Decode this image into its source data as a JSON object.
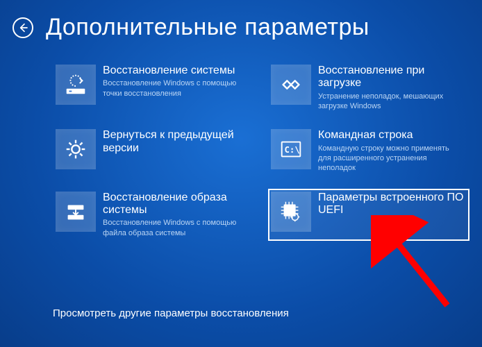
{
  "header": {
    "title": "Дополнительные параметры"
  },
  "tiles": [
    {
      "title": "Восстановление системы",
      "desc": "Восстановление Windows с помощью точки восстановления"
    },
    {
      "title": "Восстановление при загрузке",
      "desc": "Устранение неполадок, мешающих загрузке Windows"
    },
    {
      "title": "Вернуться к предыдущей версии",
      "desc": ""
    },
    {
      "title": "Командная строка",
      "desc": "Командную строку можно применять для расширенного устранения неполадок"
    },
    {
      "title": "Восстановление образа системы",
      "desc": "Восстановление Windows с помощью файла образа системы"
    },
    {
      "title": "Параметры встроенного ПО UEFI",
      "desc": ""
    }
  ],
  "footer": {
    "more": "Просмотреть другие параметры восстановления"
  }
}
